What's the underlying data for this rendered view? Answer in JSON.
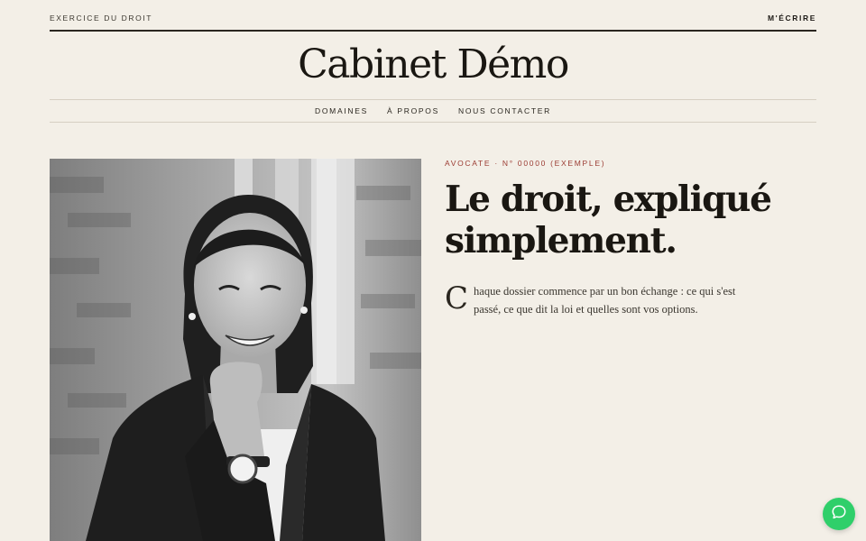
{
  "topbar": {
    "left_label": "EXERCICE DU DROIT",
    "right_link": "M'ÉCRIRE"
  },
  "masthead": {
    "title": "Cabinet Démo"
  },
  "nav": {
    "items": [
      "DOMAINES",
      "À PROPOS",
      "NOUS CONTACTER"
    ]
  },
  "hero": {
    "eyebrow": "AVOCATE · N° 00000 (EXEMPLE)",
    "headline_line1": "Le droit, expliqué",
    "headline_line2": "simplement.",
    "dropcap": "C",
    "lead": "haque dossier commence par un bon échange : ce qui s'est passé, ce que dit la loi et quelles sont vos options."
  },
  "colors": {
    "background": "#f3efe7",
    "ink": "#1d1a16",
    "accent": "#9b3b32",
    "chat": "#2fcf6a"
  },
  "icons": {
    "chat": "chat-bubble-icon"
  }
}
